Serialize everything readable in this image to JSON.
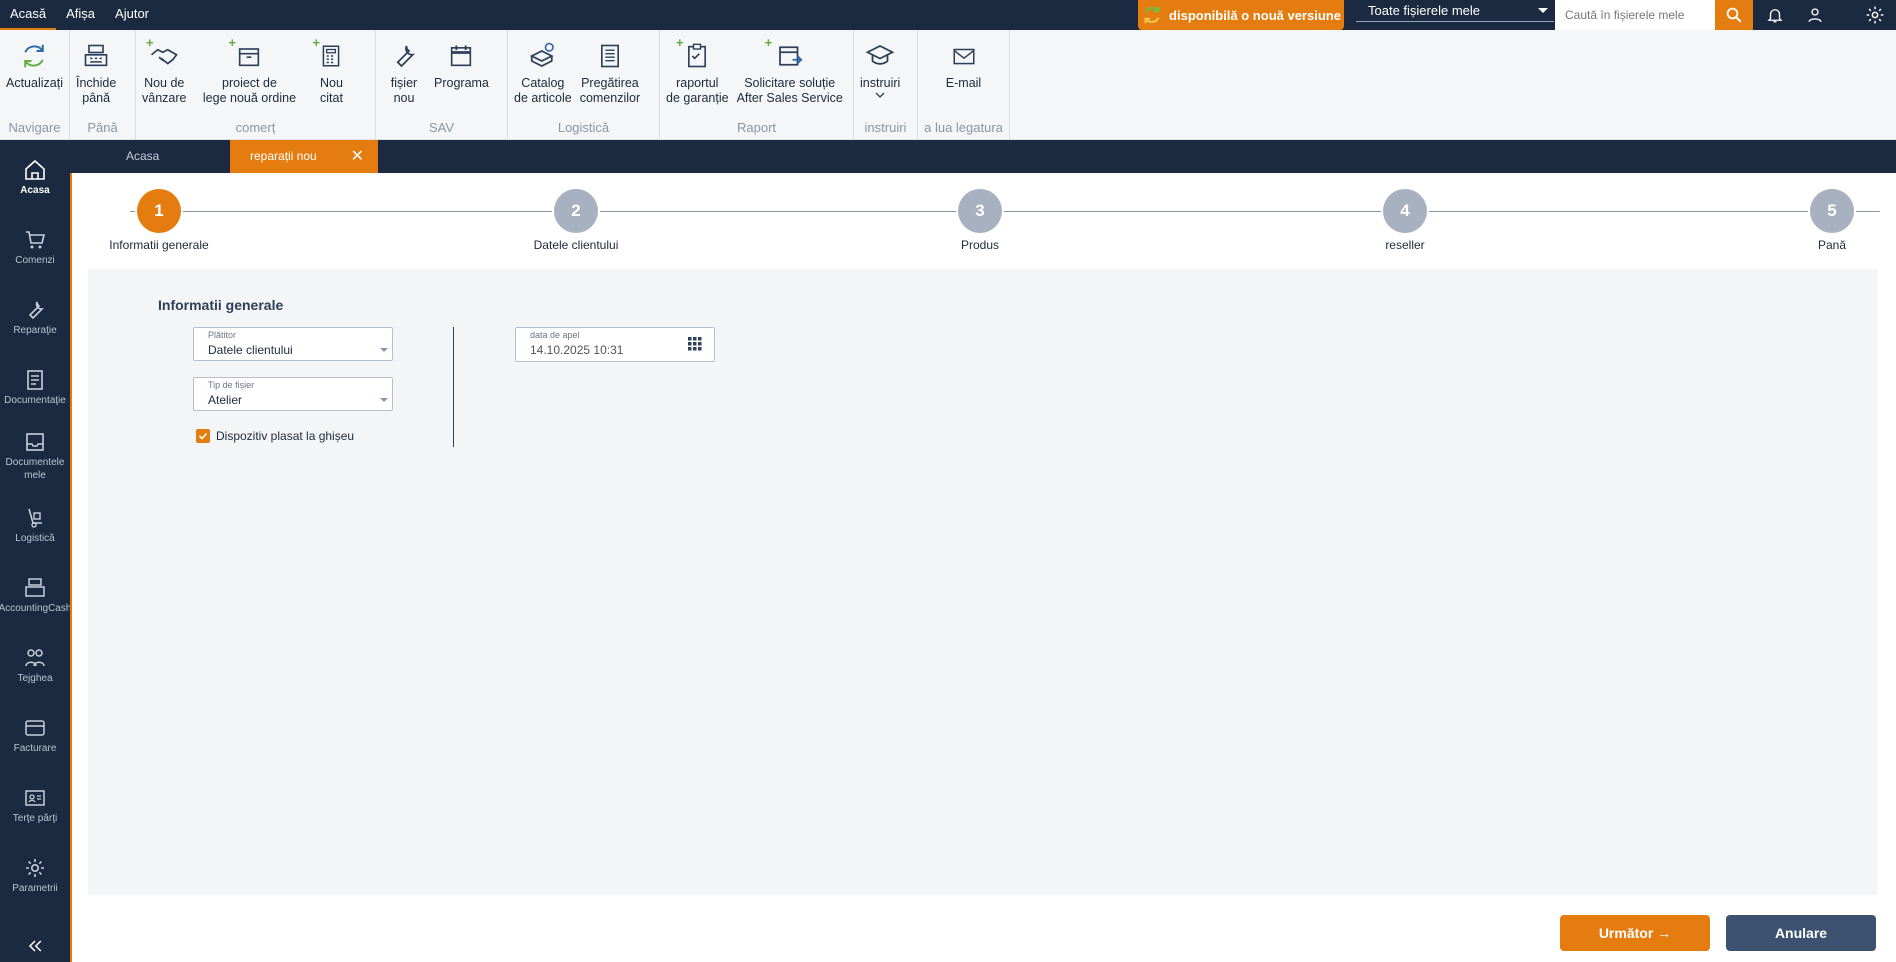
{
  "menu": [
    "Acasă",
    "Afișa",
    "Ajutor"
  ],
  "top": {
    "new_version": "disponibilă o nouă versiune",
    "scope_select": "Toate fișierele mele",
    "search_placeholder": "Caută în fișierele mele"
  },
  "ribbon": {
    "groups": [
      {
        "label": "Navigare",
        "buttons": [
          "Actualizați"
        ]
      },
      {
        "label": "Până",
        "buttons": [
          "Închide\npână"
        ]
      },
      {
        "label": "comerț",
        "buttons": [
          "Nou de\nvânzare",
          "proiect de\nlege nouă ordine",
          "Nou\ncitat"
        ]
      },
      {
        "label": "SAV",
        "buttons": [
          "fișier\nnou",
          "Programa"
        ]
      },
      {
        "label": "Logistică",
        "buttons": [
          "Catalog\nde articole",
          "Pregătirea\ncomenzilor"
        ]
      },
      {
        "label": "Raport",
        "buttons": [
          "raportul\nde garanție",
          "Solicitare soluție\nAfter Sales Service"
        ]
      },
      {
        "label": "instruiri",
        "buttons": [
          "instruiri"
        ]
      },
      {
        "label": "a lua legatura",
        "buttons": [
          "E-mail"
        ]
      }
    ]
  },
  "sidebar": [
    "Acasa",
    "Comenzi",
    "Reparaţie",
    "Documentaţie",
    "Documentele mele",
    "Logistică",
    "AccountingCash",
    "Tejghea",
    "Facturare",
    "Terţe părţi",
    "Parametrii"
  ],
  "tabs": {
    "home": "Acasa",
    "active": "reparații nou"
  },
  "steps": [
    {
      "num": "1",
      "label": "Informatii generale"
    },
    {
      "num": "2",
      "label": "Datele clientului"
    },
    {
      "num": "3",
      "label": "Produs"
    },
    {
      "num": "4",
      "label": "reseller"
    },
    {
      "num": "5",
      "label": "Pană"
    }
  ],
  "form": {
    "title": "Informatii generale",
    "payer": {
      "label": "Plătitor",
      "value": "Datele clientului"
    },
    "file_type": {
      "label": "Tip de fișier",
      "value": "Atelier"
    },
    "call_date": {
      "label": "data de apel",
      "value": "14.10.2025 10:31"
    },
    "checkbox": {
      "label": "Dispozitiv plasat la ghișeu",
      "checked": true
    }
  },
  "buttons": {
    "next": "Următor →",
    "cancel": "Anulare"
  },
  "colors": {
    "accent": "#e57c10",
    "navy": "#1b2a40",
    "cancel": "#3d5270"
  }
}
